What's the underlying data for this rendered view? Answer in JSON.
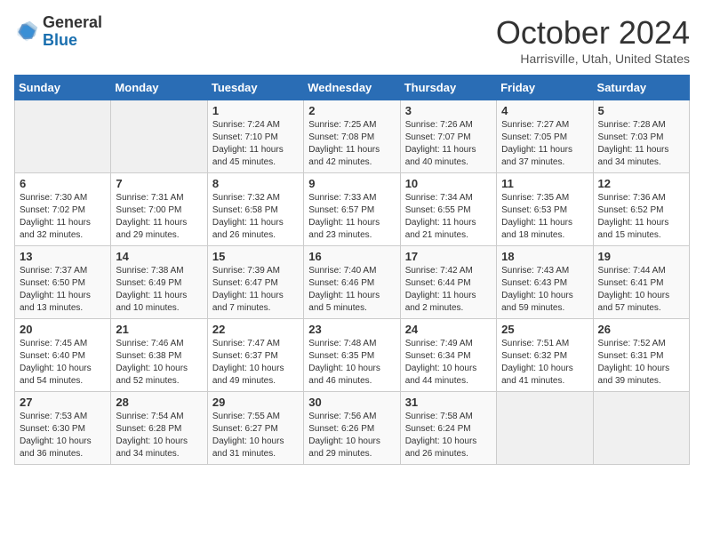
{
  "header": {
    "logo": {
      "general": "General",
      "blue": "Blue"
    },
    "month": "October 2024",
    "location": "Harrisville, Utah, United States"
  },
  "days_of_week": [
    "Sunday",
    "Monday",
    "Tuesday",
    "Wednesday",
    "Thursday",
    "Friday",
    "Saturday"
  ],
  "weeks": [
    [
      {
        "day": "",
        "info": ""
      },
      {
        "day": "",
        "info": ""
      },
      {
        "day": "1",
        "info": "Sunrise: 7:24 AM\nSunset: 7:10 PM\nDaylight: 11 hours and 45 minutes."
      },
      {
        "day": "2",
        "info": "Sunrise: 7:25 AM\nSunset: 7:08 PM\nDaylight: 11 hours and 42 minutes."
      },
      {
        "day": "3",
        "info": "Sunrise: 7:26 AM\nSunset: 7:07 PM\nDaylight: 11 hours and 40 minutes."
      },
      {
        "day": "4",
        "info": "Sunrise: 7:27 AM\nSunset: 7:05 PM\nDaylight: 11 hours and 37 minutes."
      },
      {
        "day": "5",
        "info": "Sunrise: 7:28 AM\nSunset: 7:03 PM\nDaylight: 11 hours and 34 minutes."
      }
    ],
    [
      {
        "day": "6",
        "info": "Sunrise: 7:30 AM\nSunset: 7:02 PM\nDaylight: 11 hours and 32 minutes."
      },
      {
        "day": "7",
        "info": "Sunrise: 7:31 AM\nSunset: 7:00 PM\nDaylight: 11 hours and 29 minutes."
      },
      {
        "day": "8",
        "info": "Sunrise: 7:32 AM\nSunset: 6:58 PM\nDaylight: 11 hours and 26 minutes."
      },
      {
        "day": "9",
        "info": "Sunrise: 7:33 AM\nSunset: 6:57 PM\nDaylight: 11 hours and 23 minutes."
      },
      {
        "day": "10",
        "info": "Sunrise: 7:34 AM\nSunset: 6:55 PM\nDaylight: 11 hours and 21 minutes."
      },
      {
        "day": "11",
        "info": "Sunrise: 7:35 AM\nSunset: 6:53 PM\nDaylight: 11 hours and 18 minutes."
      },
      {
        "day": "12",
        "info": "Sunrise: 7:36 AM\nSunset: 6:52 PM\nDaylight: 11 hours and 15 minutes."
      }
    ],
    [
      {
        "day": "13",
        "info": "Sunrise: 7:37 AM\nSunset: 6:50 PM\nDaylight: 11 hours and 13 minutes."
      },
      {
        "day": "14",
        "info": "Sunrise: 7:38 AM\nSunset: 6:49 PM\nDaylight: 11 hours and 10 minutes."
      },
      {
        "day": "15",
        "info": "Sunrise: 7:39 AM\nSunset: 6:47 PM\nDaylight: 11 hours and 7 minutes."
      },
      {
        "day": "16",
        "info": "Sunrise: 7:40 AM\nSunset: 6:46 PM\nDaylight: 11 hours and 5 minutes."
      },
      {
        "day": "17",
        "info": "Sunrise: 7:42 AM\nSunset: 6:44 PM\nDaylight: 11 hours and 2 minutes."
      },
      {
        "day": "18",
        "info": "Sunrise: 7:43 AM\nSunset: 6:43 PM\nDaylight: 10 hours and 59 minutes."
      },
      {
        "day": "19",
        "info": "Sunrise: 7:44 AM\nSunset: 6:41 PM\nDaylight: 10 hours and 57 minutes."
      }
    ],
    [
      {
        "day": "20",
        "info": "Sunrise: 7:45 AM\nSunset: 6:40 PM\nDaylight: 10 hours and 54 minutes."
      },
      {
        "day": "21",
        "info": "Sunrise: 7:46 AM\nSunset: 6:38 PM\nDaylight: 10 hours and 52 minutes."
      },
      {
        "day": "22",
        "info": "Sunrise: 7:47 AM\nSunset: 6:37 PM\nDaylight: 10 hours and 49 minutes."
      },
      {
        "day": "23",
        "info": "Sunrise: 7:48 AM\nSunset: 6:35 PM\nDaylight: 10 hours and 46 minutes."
      },
      {
        "day": "24",
        "info": "Sunrise: 7:49 AM\nSunset: 6:34 PM\nDaylight: 10 hours and 44 minutes."
      },
      {
        "day": "25",
        "info": "Sunrise: 7:51 AM\nSunset: 6:32 PM\nDaylight: 10 hours and 41 minutes."
      },
      {
        "day": "26",
        "info": "Sunrise: 7:52 AM\nSunset: 6:31 PM\nDaylight: 10 hours and 39 minutes."
      }
    ],
    [
      {
        "day": "27",
        "info": "Sunrise: 7:53 AM\nSunset: 6:30 PM\nDaylight: 10 hours and 36 minutes."
      },
      {
        "day": "28",
        "info": "Sunrise: 7:54 AM\nSunset: 6:28 PM\nDaylight: 10 hours and 34 minutes."
      },
      {
        "day": "29",
        "info": "Sunrise: 7:55 AM\nSunset: 6:27 PM\nDaylight: 10 hours and 31 minutes."
      },
      {
        "day": "30",
        "info": "Sunrise: 7:56 AM\nSunset: 6:26 PM\nDaylight: 10 hours and 29 minutes."
      },
      {
        "day": "31",
        "info": "Sunrise: 7:58 AM\nSunset: 6:24 PM\nDaylight: 10 hours and 26 minutes."
      },
      {
        "day": "",
        "info": ""
      },
      {
        "day": "",
        "info": ""
      }
    ]
  ]
}
